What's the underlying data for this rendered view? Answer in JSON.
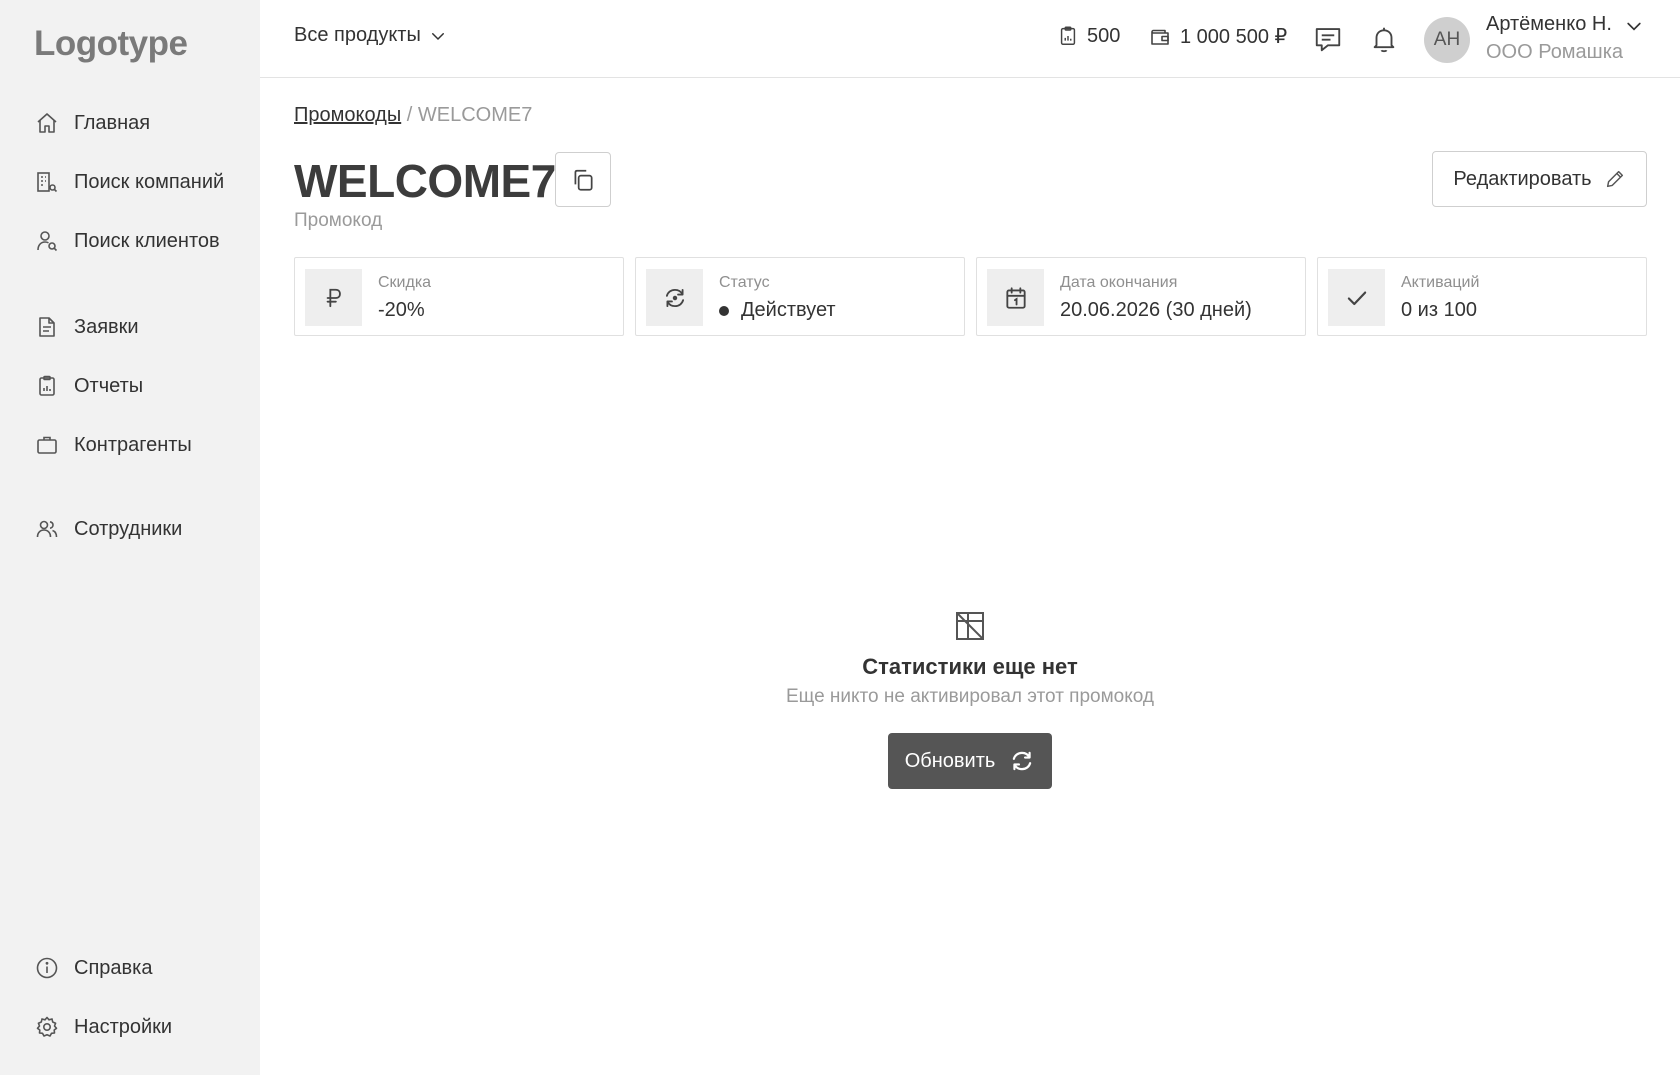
{
  "sidebar": {
    "logo": "Logotype",
    "items": [
      {
        "label": "Главная",
        "icon": "home-icon"
      },
      {
        "label": "Поиск компаний",
        "icon": "building-search-icon"
      },
      {
        "label": "Поиск клиентов",
        "icon": "user-search-icon"
      },
      {
        "label": "Заявки",
        "icon": "document-icon"
      },
      {
        "label": "Отчеты",
        "icon": "clipboard-icon"
      },
      {
        "label": "Контрагенты",
        "icon": "briefcase-icon"
      },
      {
        "label": "Сотрудники",
        "icon": "users-icon"
      }
    ],
    "bottom_items": [
      {
        "label": "Справка",
        "icon": "info-icon"
      },
      {
        "label": "Настройки",
        "icon": "gear-icon"
      }
    ]
  },
  "header": {
    "products_label": "Все продукты",
    "reports_count": "500",
    "balance": "1 000 500 ₽",
    "user": {
      "initials": "АН",
      "name": "Артёменко Н.",
      "org": "ООО Ромашка"
    }
  },
  "breadcrumb": {
    "parent": "Промокоды",
    "separator": "/",
    "current": "WELCOME7"
  },
  "promo": {
    "title": "WELCOME7",
    "subtitle": "Промокод",
    "edit_label": "Редактировать"
  },
  "cards": [
    {
      "label": "Скидка",
      "value": "-20%",
      "icon": "ruble-icon"
    },
    {
      "label": "Статус",
      "value": "Действует",
      "icon": "refresh-status-icon"
    },
    {
      "label": "Дата окончания",
      "value": "20.06.2026 (30 дней)",
      "icon": "calendar-icon"
    },
    {
      "label": "Активаций",
      "value": "0 из 100",
      "icon": "check-icon"
    }
  ],
  "empty_state": {
    "title": "Статистики еще нет",
    "subtitle": "Еще никто не активировал этот промокод",
    "button_label": "Обновить"
  },
  "colors": {
    "sidebar_bg": "#f2f2f2",
    "primary_button": "#555555",
    "muted_text": "#9a9a9a"
  }
}
